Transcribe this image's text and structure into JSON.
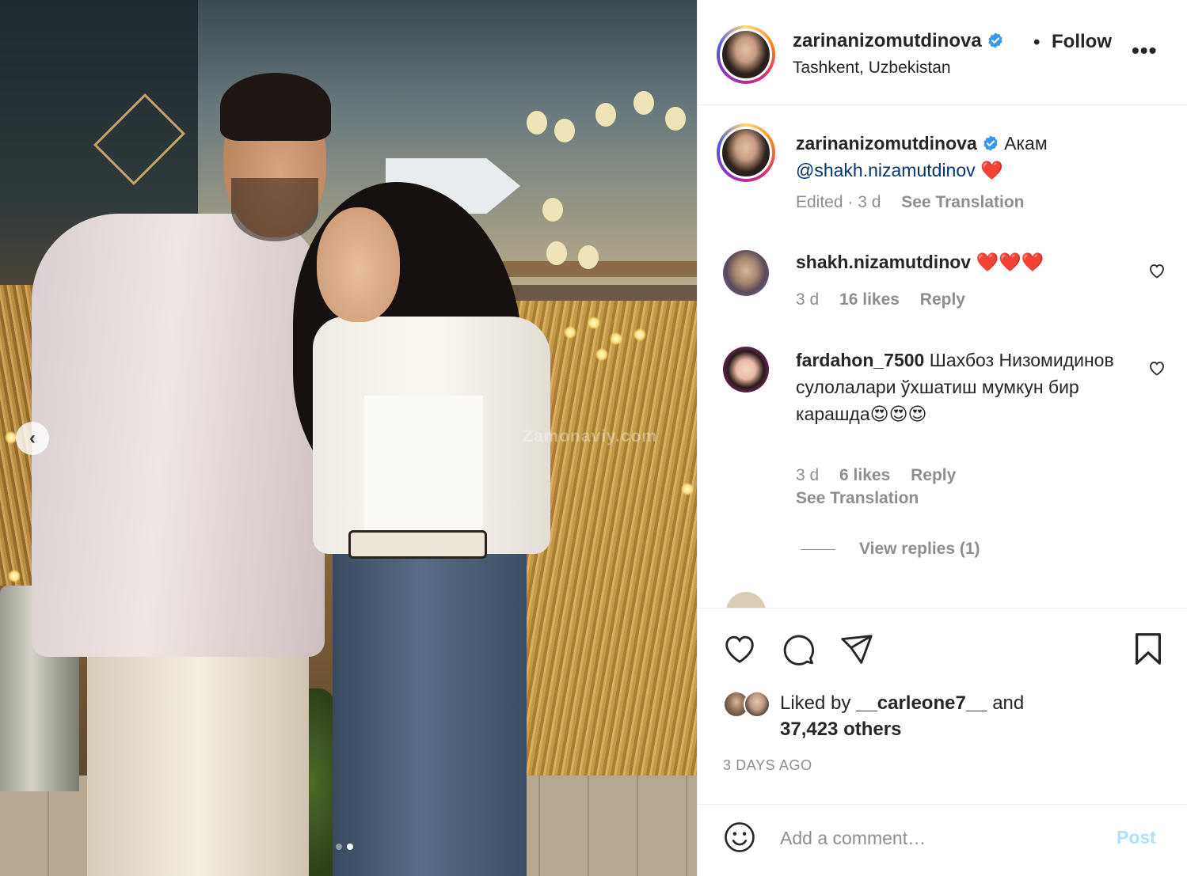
{
  "post": {
    "username": "zarinanizomutdinova",
    "separator": "•",
    "follow_label": "Follow",
    "location": "Tashkent, Uzbekistan",
    "more_label": "•••",
    "watermark": "Zamonaviy.com",
    "carousel": {
      "prev_label": "‹",
      "slide_count": 2,
      "active_slide": 2
    }
  },
  "caption": {
    "username": "zarinanizomutdinova",
    "text": "Акам",
    "mention": "@shakh.nizamutdinov",
    "emoji": "❤️",
    "edited": "Edited · 3 d",
    "see_translation": "See Translation"
  },
  "comments": [
    {
      "username": "shakh.nizamutdinov",
      "text": "❤️❤️❤️",
      "time": "3 d",
      "likes": "16 likes",
      "reply": "Reply"
    },
    {
      "username": "fardahon_7500",
      "text": "Шахбоз Низомидинов сулолалари ўхшатиш мумкун бир карашда😍😍😍",
      "time": "3 d",
      "likes": "6 likes",
      "reply": "Reply",
      "see_translation": "See Translation",
      "view_replies": "View replies (1)"
    }
  ],
  "likes": {
    "prefix": "Liked by",
    "user": "__carleone7__",
    "and": "and",
    "others": "37,423 others"
  },
  "timestamp": "3 DAYS AGO",
  "add_comment": {
    "placeholder": "Add a comment…",
    "post_label": "Post"
  },
  "colors": {
    "text": "#262626",
    "secondary": "#8e8e8e",
    "link": "#00376b",
    "verified": "#3897f0",
    "post_disabled": "#b2dffc",
    "heart_red": "#ed4956"
  }
}
